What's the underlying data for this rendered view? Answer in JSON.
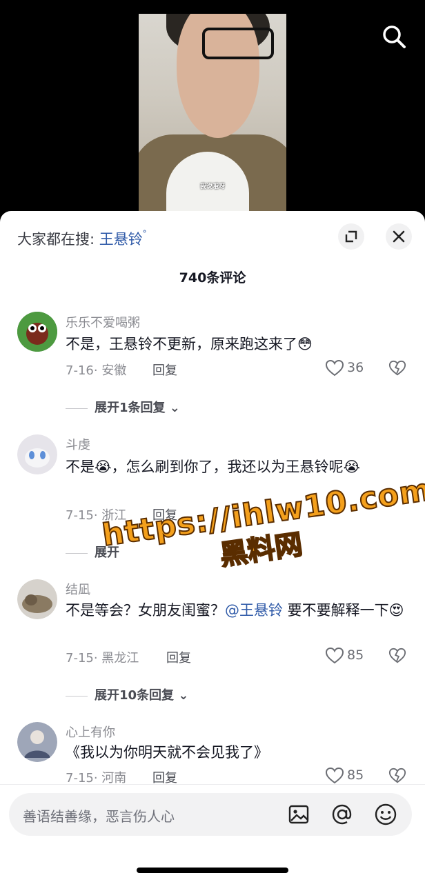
{
  "video": {
    "subtitle": "我说哦呀"
  },
  "hot_search": {
    "prefix": "大家都在搜:",
    "term": "王悬铃",
    "suffix": "ᐤ"
  },
  "comment_count": "740条评论",
  "comments": [
    {
      "user": "乐乐不爱喝粥",
      "text": "不是，王悬铃不更新，原来跑这来了😳",
      "meta": "7-16· 安徽",
      "reply": "回复",
      "likes": "36",
      "expand": "展开1条回复"
    },
    {
      "user": "斗虔",
      "text": "不是😭，怎么刷到你了，我还以为王悬铃呢😭",
      "meta": "7-15· 浙江",
      "reply": "回复",
      "expand": "展开"
    },
    {
      "user": "结凪",
      "text_pre": "不是等会？女朋友闺蜜？",
      "mention": "@王悬铃",
      "text_post": " 要不要解释一下😍",
      "meta": "7-15· 黑龙江",
      "reply": "回复",
      "likes": "85",
      "expand": "展开10条回复"
    },
    {
      "user": "心上有你",
      "text": "《我以为你明天就不会见我了》",
      "meta": "7-15· 河南",
      "reply": "回复",
      "likes": "85"
    }
  ],
  "watermark": {
    "url": "https://ihlw10.com",
    "cn": "黑料网"
  },
  "input": {
    "placeholder": "善语结善缘，恶言伤人心"
  },
  "icons": [
    "search-icon",
    "expand-icon",
    "close-icon",
    "heart-icon",
    "broken-heart-icon",
    "chevron-down-icon",
    "image-icon",
    "at-icon",
    "emoji-icon"
  ]
}
